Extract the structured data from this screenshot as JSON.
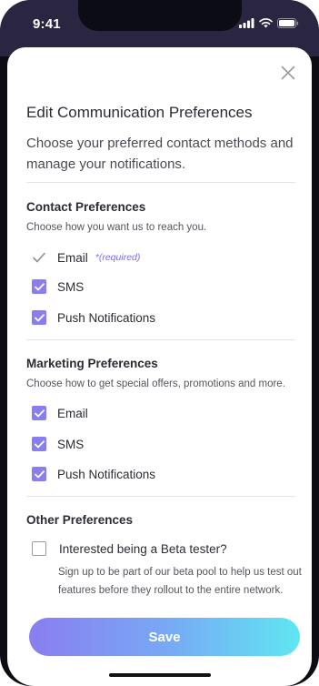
{
  "status_bar": {
    "time": "9:41"
  },
  "header": {
    "title": "Edit Communication Preferences",
    "subtitle": "Choose your preferred contact methods and manage your notifications."
  },
  "contact": {
    "title": "Contact Preferences",
    "description": "Choose how you want us to reach you.",
    "options": [
      {
        "label": "Email",
        "note": "*(required)",
        "state": "locked"
      },
      {
        "label": "SMS",
        "state": "checked"
      },
      {
        "label": "Push Notifications",
        "state": "checked"
      }
    ]
  },
  "marketing": {
    "title": "Marketing Preferences",
    "description": "Choose how to get special offers, promotions and more.",
    "options": [
      {
        "label": "Email",
        "state": "checked"
      },
      {
        "label": "SMS",
        "state": "checked"
      },
      {
        "label": "Push Notifications",
        "state": "checked"
      }
    ]
  },
  "other": {
    "title": "Other Preferences",
    "beta": {
      "label": "Interested being a Beta tester?",
      "description": "Sign up to be part of our beta pool to help us test out features before they rollout to the entire network.",
      "state": "unchecked"
    }
  },
  "footer": {
    "save_label": "Save"
  },
  "colors": {
    "accent": "#8a7df0",
    "gradient_end": "#5fe6f2",
    "status_bg": "#2a2540"
  },
  "icons": {
    "close": "close-icon",
    "check": "check-icon",
    "signal": "signal-icon",
    "wifi": "wifi-icon",
    "battery": "battery-icon"
  }
}
